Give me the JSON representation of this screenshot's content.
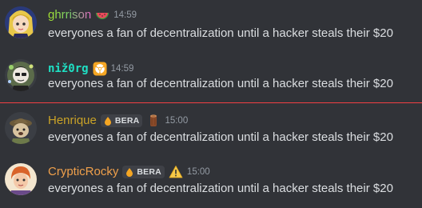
{
  "messages": [
    {
      "username": "ghrrison",
      "username_colors": [
        "#a6e22e",
        "#e864c8"
      ],
      "badge_icon": "watermelon-icon",
      "timestamp": "14:59",
      "content": "everyones a fan of decentralization until a hacker steals their $20"
    },
    {
      "username": "niž0rg",
      "username_color": "#1fe0c4",
      "badge_icon": "radioactive-icon",
      "timestamp": "14:59",
      "content": "everyones a fan of decentralization until a hacker steals their $20"
    },
    {
      "username": "Henrique",
      "username_color": "#c9a227",
      "role_tag": "BERA",
      "badge_icon": "wood-log-icon",
      "timestamp": "15:00",
      "content": "everyones a fan of decentralization until a hacker steals their $20"
    },
    {
      "username": "CrypticRocky",
      "username_color": "#f0a04b",
      "role_tag": "BERA",
      "badge_icon": "warning-icon",
      "timestamp": "15:00",
      "content": "everyones a fan of decentralization until a hacker steals their $20"
    }
  ],
  "new_messages_divider_color": "#f23f43"
}
